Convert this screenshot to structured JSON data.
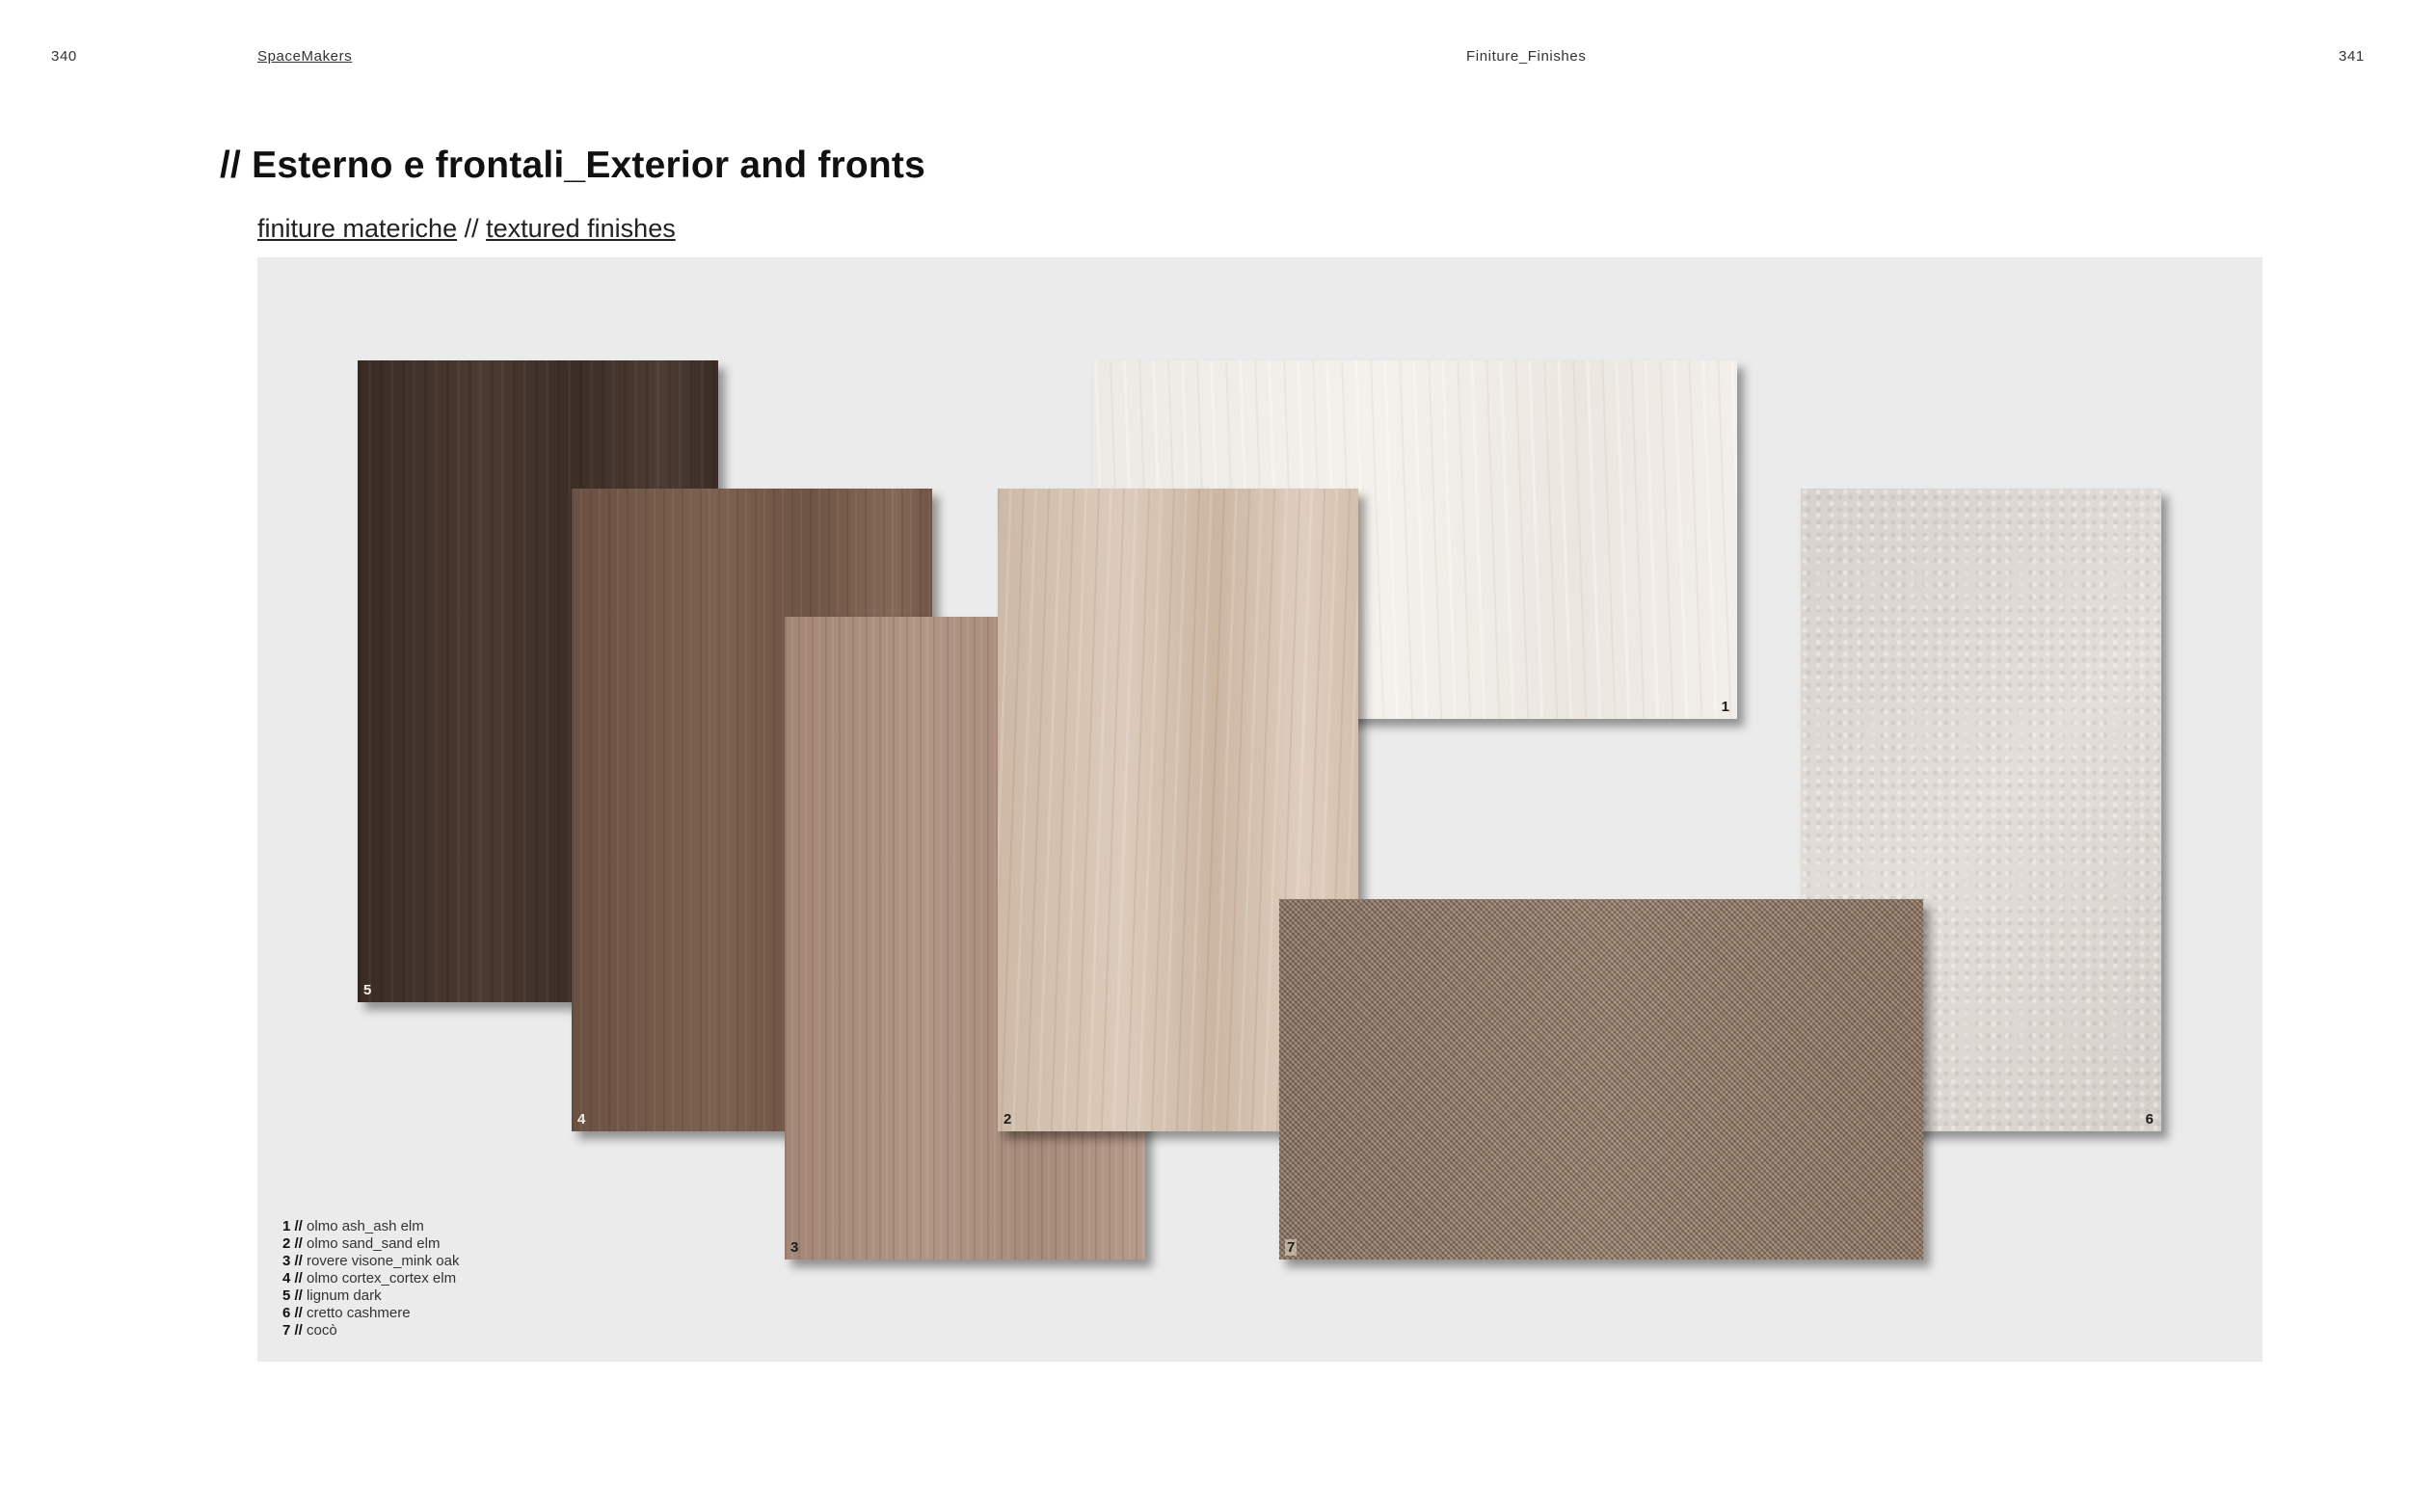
{
  "header": {
    "page_left": "340",
    "brand": "SpaceMakers",
    "section": "Finiture_Finishes",
    "page_right": "341"
  },
  "title": "// Esterno e frontali_Exterior and fronts",
  "subtitle": {
    "it": "finiture materiche",
    "sep": " // ",
    "en": "textured finishes"
  },
  "swatches": [
    {
      "number": "5",
      "name": "lignum dark"
    },
    {
      "number": "4",
      "name": "olmo cortex_cortex elm"
    },
    {
      "number": "3",
      "name": "rovere visone_mink oak"
    },
    {
      "number": "2",
      "name": "olmo sand_sand elm"
    },
    {
      "number": "1",
      "name": "olmo ash_ash elm"
    },
    {
      "number": "6",
      "name": "cretto cashmere"
    },
    {
      "number": "7",
      "name": "cocò"
    }
  ],
  "legend": [
    {
      "num": "1 //",
      "label": "olmo ash_ash elm"
    },
    {
      "num": "2 //",
      "label": "olmo sand_sand elm"
    },
    {
      "num": "3 //",
      "label": "rovere visone_mink oak"
    },
    {
      "num": "4 //",
      "label": "olmo cortex_cortex elm"
    },
    {
      "num": "5 //",
      "label": "lignum dark"
    },
    {
      "num": "6 //",
      "label": "cretto cashmere"
    },
    {
      "num": "7 //",
      "label": "cocò"
    }
  ]
}
